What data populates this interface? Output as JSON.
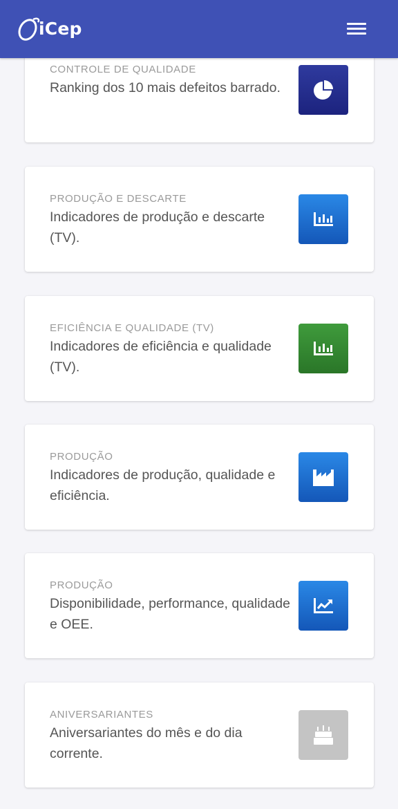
{
  "header": {
    "brand": "iCep",
    "menu_icon": "hamburger-menu-icon"
  },
  "cards": [
    {
      "category": "CONTROLE DE QUALIDADE",
      "description": "Ranking dos 10 mais defeitos barrado.",
      "icon": "pie-chart-icon",
      "color": "#283593"
    },
    {
      "category": "PRODUÇÃO E DESCARTE",
      "description": "Indicadores de produção e descarte (TV).",
      "icon": "bar-chart-icon",
      "color": "#1e6fd0"
    },
    {
      "category": "EFICIÊNCIA E QUALIDADE (TV)",
      "description": "Indicadores de eficiência e qualidade (TV).",
      "icon": "bar-chart-icon",
      "color": "#348a32"
    },
    {
      "category": "PRODUÇÃO",
      "description": "Indicadores de produção, qualidade e eficiência.",
      "icon": "factory-icon",
      "color": "#1e6fd0"
    },
    {
      "category": "PRODUÇÃO",
      "description": "Disponibilidade, performance, qualidade e OEE.",
      "icon": "trending-up-icon",
      "color": "#1e6fd0"
    },
    {
      "category": "ANIVERSARIANTES",
      "description": "Aniversariantes do mês e do dia corrente.",
      "icon": "cake-icon",
      "color": "#c4c4c4"
    }
  ]
}
